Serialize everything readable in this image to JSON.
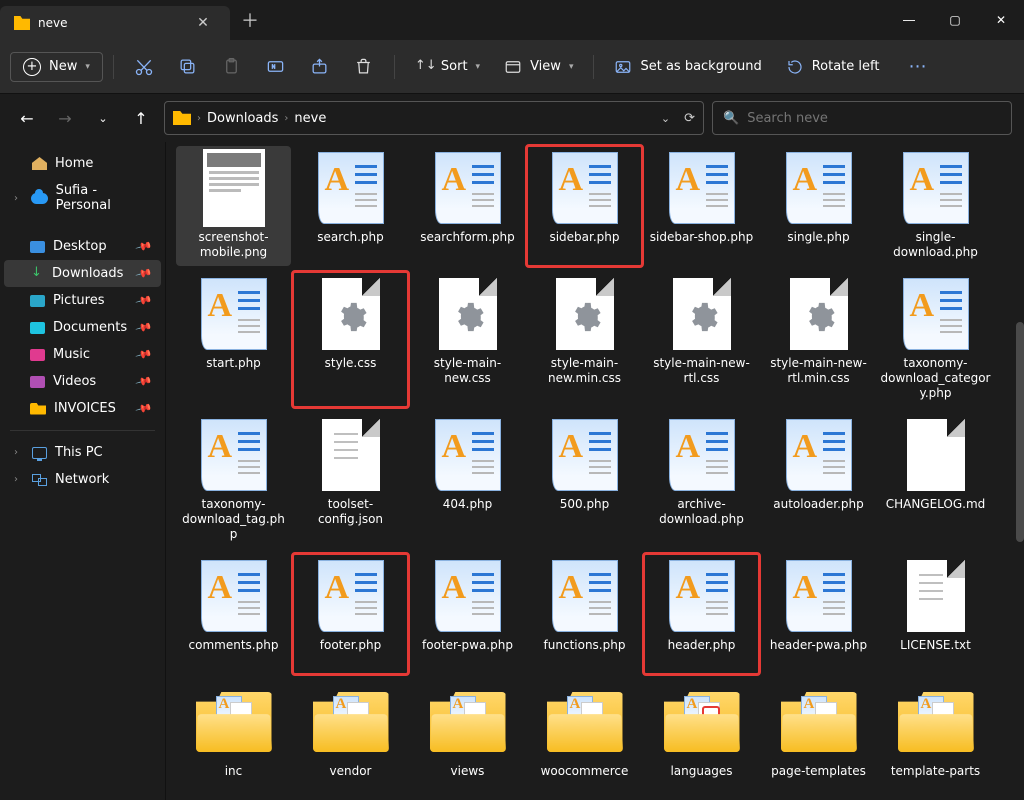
{
  "window": {
    "title": "neve"
  },
  "toolbar": {
    "new_label": "New",
    "sort_label": "Sort",
    "view_label": "View",
    "background_label": "Set as background",
    "rotate_label": "Rotate left"
  },
  "breadcrumb": {
    "segments": [
      "Downloads",
      "neve"
    ]
  },
  "search": {
    "placeholder": "Search neve"
  },
  "sidebar": {
    "home": "Home",
    "personal": "Sufia - Personal",
    "quick": [
      {
        "label": "Desktop",
        "icon": "blue"
      },
      {
        "label": "Downloads",
        "icon": "dl",
        "active": true
      },
      {
        "label": "Pictures",
        "icon": "teal"
      },
      {
        "label": "Documents",
        "icon": "cyan"
      },
      {
        "label": "Music",
        "icon": "mag"
      },
      {
        "label": "Videos",
        "icon": "purple"
      },
      {
        "label": "INVOICES",
        "icon": "gold"
      }
    ],
    "this_pc": "This PC",
    "network": "Network"
  },
  "files": [
    {
      "name": "screenshot-mobile.png",
      "type": "shot",
      "selected": true
    },
    {
      "name": "search.php",
      "type": "code"
    },
    {
      "name": "searchform.php",
      "type": "code"
    },
    {
      "name": "sidebar.php",
      "type": "code",
      "highlight": true
    },
    {
      "name": "sidebar-shop.php",
      "type": "code"
    },
    {
      "name": "single.php",
      "type": "code"
    },
    {
      "name": "single-download.php",
      "type": "code"
    },
    {
      "name": "start.php",
      "type": "code"
    },
    {
      "name": "style.css",
      "type": "gear",
      "highlight": true
    },
    {
      "name": "style-main-new.css",
      "type": "gear"
    },
    {
      "name": "style-main-new.min.css",
      "type": "gear"
    },
    {
      "name": "style-main-new-rtl.css",
      "type": "gear"
    },
    {
      "name": "style-main-new-rtl.min.css",
      "type": "gear"
    },
    {
      "name": "taxonomy-download_category.php",
      "type": "code"
    },
    {
      "name": "taxonomy-download_tag.php",
      "type": "code"
    },
    {
      "name": "toolset-config.json",
      "type": "plain-lines"
    },
    {
      "name": "404.php",
      "type": "code"
    },
    {
      "name": "500.php",
      "type": "code"
    },
    {
      "name": "archive-download.php",
      "type": "code"
    },
    {
      "name": "autoloader.php",
      "type": "code"
    },
    {
      "name": "CHANGELOG.md",
      "type": "plain"
    },
    {
      "name": "comments.php",
      "type": "code"
    },
    {
      "name": "footer.php",
      "type": "code",
      "highlight": true
    },
    {
      "name": "footer-pwa.php",
      "type": "code"
    },
    {
      "name": "functions.php",
      "type": "code"
    },
    {
      "name": "header.php",
      "type": "code",
      "highlight": true
    },
    {
      "name": "header-pwa.php",
      "type": "code"
    },
    {
      "name": "LICENSE.txt",
      "type": "plain-lines"
    },
    {
      "name": "inc",
      "type": "folder"
    },
    {
      "name": "vendor",
      "type": "folder"
    },
    {
      "name": "views",
      "type": "folder"
    },
    {
      "name": "woocommerce",
      "type": "folder"
    },
    {
      "name": "languages",
      "type": "folder-red"
    },
    {
      "name": "page-templates",
      "type": "folder"
    },
    {
      "name": "template-parts",
      "type": "folder"
    }
  ]
}
